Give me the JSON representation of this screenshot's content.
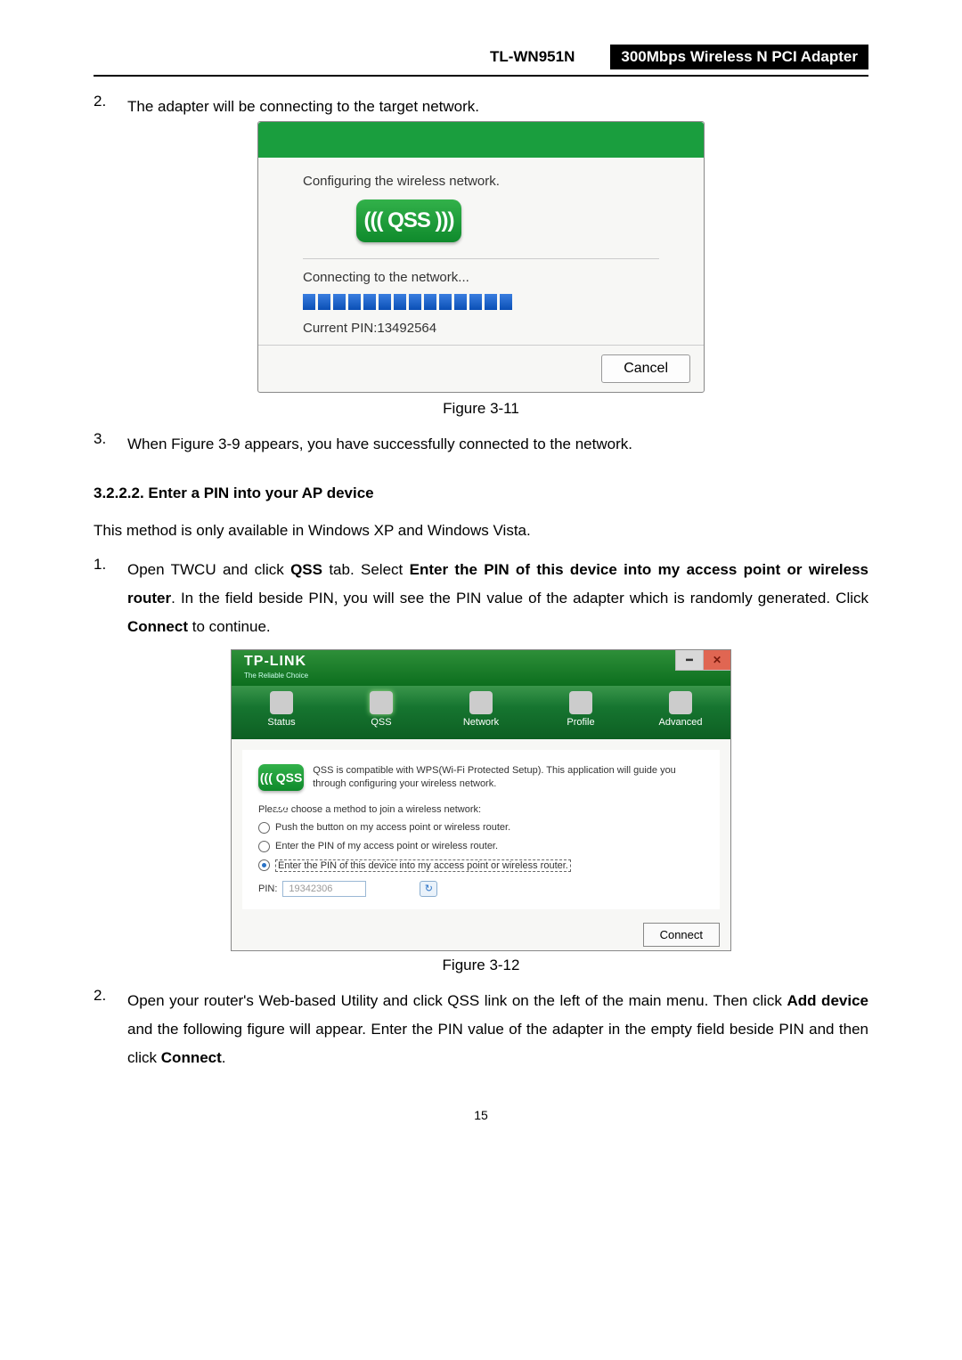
{
  "header": {
    "model": "TL-WN951N",
    "product": "300Mbps Wireless N PCI Adapter"
  },
  "step2_top": "The adapter will be connecting to the target network.",
  "dialog1": {
    "configuring": "Configuring the wireless network.",
    "qss_label": "((( QSS )))",
    "connecting": "Connecting to the network...",
    "pin_line": "Current PIN:13492564",
    "cancel": "Cancel"
  },
  "fig311": "Figure 3-11",
  "step3_top": "When Figure 3-9 appears, you have successfully connected to the network.",
  "section_heading": "3.2.2.2.  Enter a PIN into your AP device",
  "method_note": "This method is only available in Windows XP and Windows Vista.",
  "step1_mid_pre": "Open TWCU and click ",
  "step1_mid_bold1": "QSS",
  "step1_mid_mid1": " tab. Select ",
  "step1_mid_bold2": "Enter the PIN of this device into my access point or wireless router",
  "step1_mid_mid2": ". In the field beside PIN, you will see the PIN value of the adapter which is randomly generated. Click ",
  "step1_mid_bold3": "Connect",
  "step1_mid_end": " to continue.",
  "twcu": {
    "brand": "TP-LINK",
    "tagline": "The Reliable Choice",
    "tabs": {
      "status": "Status",
      "qss": "QSS",
      "network": "Network",
      "profile": "Profile",
      "advanced": "Advanced"
    },
    "intro": "QSS is compatible with WPS(Wi-Fi Protected Setup). This application will guide you through configuring your wireless network.",
    "choose": "Please choose a method to join a wireless network:",
    "opt1": "Push the button on my access point or wireless router.",
    "opt2": "Enter the PIN of my access point or wireless router.",
    "opt3": "Enter the PIN of this device into my access point or wireless router.",
    "pin_label": "PIN:",
    "pin_value": "19342306",
    "connect": "Connect"
  },
  "fig312": "Figure 3-12",
  "step2_bot_pre": "Open your router's Web-based Utility and click QSS link on the left of the main menu. Then click ",
  "step2_bot_bold1": "Add device",
  "step2_bot_mid": " and the following figure will appear. Enter the PIN value of the adapter in the empty field beside PIN and then click ",
  "step2_bot_bold2": "Connect",
  "step2_bot_end": ".",
  "page_num": "15"
}
